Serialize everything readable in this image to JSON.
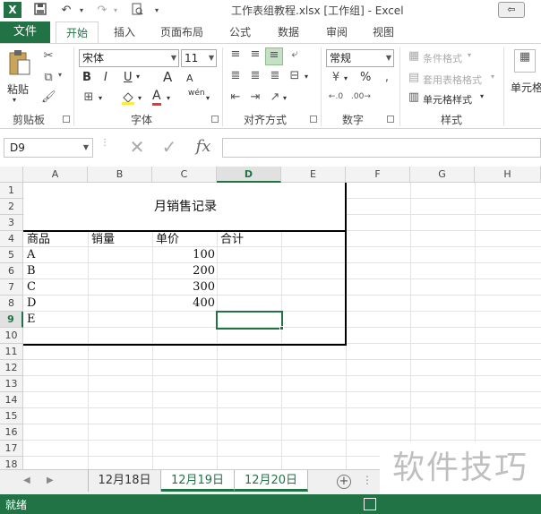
{
  "window": {
    "title": "工作表组教程.xlsx  [工作组] - Excel",
    "app_logo": "X",
    "restore_label": "⇦"
  },
  "qat": {
    "save_icon": "save-icon",
    "undo_icon": "undo-icon",
    "redo_icon": "redo-icon",
    "preview_icon": "print-preview-icon"
  },
  "ribbon_tabs": {
    "file": "文件",
    "items": [
      "开始",
      "插入",
      "页面布局",
      "公式",
      "数据",
      "审阅",
      "视图"
    ],
    "active": "开始"
  },
  "clipboard": {
    "paste": "粘贴",
    "label": "剪贴板"
  },
  "font": {
    "name": "宋体",
    "size": "11",
    "label": "字体",
    "bold": "B",
    "italic": "I",
    "underline": "U",
    "grow": "A",
    "shrink": "A",
    "color_letter": "A",
    "phonetic": "wén"
  },
  "alignment": {
    "label": "对齐方式"
  },
  "number": {
    "format": "常规",
    "label": "数字",
    "percent": "%"
  },
  "styles": {
    "conditional": "条件格式",
    "table": "套用表格格式",
    "cell": "单元格样式",
    "label": "样式"
  },
  "cells_group": {
    "label": "单元格"
  },
  "formula_bar": {
    "name_box": "D9",
    "fx": "fx",
    "formula": ""
  },
  "grid": {
    "columns": [
      "A",
      "B",
      "C",
      "D",
      "E",
      "F",
      "G",
      "H"
    ],
    "selected_column": "D",
    "rows": [
      "1",
      "2",
      "3",
      "4",
      "5",
      "6",
      "7",
      "8",
      "9",
      "10",
      "11",
      "12",
      "13",
      "14",
      "15",
      "16",
      "17",
      "18"
    ],
    "selected_row": "9",
    "title": "月销售记录",
    "headers": [
      "商品",
      "销量",
      "单价",
      "合计"
    ],
    "items": [
      {
        "name": "A",
        "price": "100"
      },
      {
        "name": "B",
        "price": "200"
      },
      {
        "name": "C",
        "price": "300"
      },
      {
        "name": "D",
        "price": "400"
      },
      {
        "name": "E",
        "price": ""
      }
    ]
  },
  "sheets": {
    "tabs": [
      "12月18日",
      "12月19日",
      "12月20日"
    ],
    "active": "12月18日",
    "add": "+"
  },
  "status": {
    "text": "就绪"
  },
  "watermark": "软件技巧"
}
